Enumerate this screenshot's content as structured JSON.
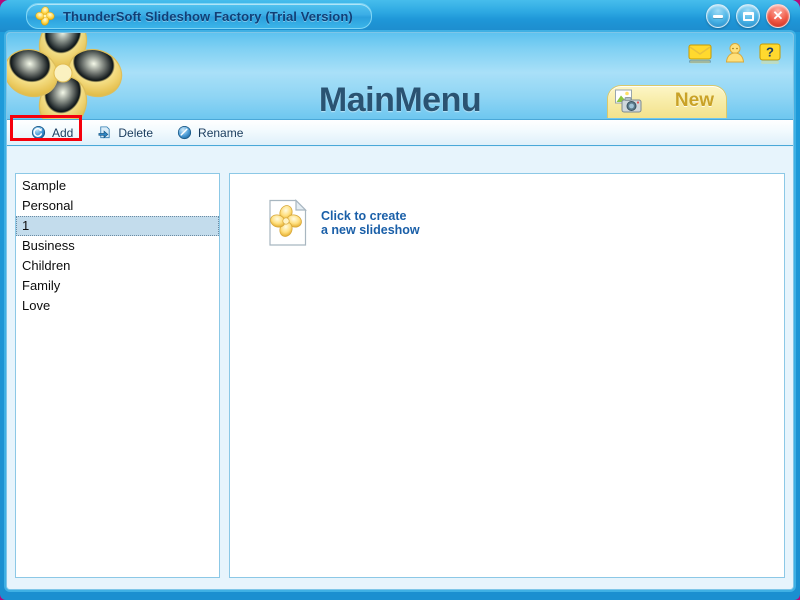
{
  "window": {
    "title": "ThunderSoft Slideshow Factory (Trial Version)",
    "app_icon": "flower-icon",
    "controls": {
      "minimize": "–",
      "maximize": "□",
      "close": "✕"
    }
  },
  "header": {
    "page_title": "MainMenu",
    "logo": "flower-logo",
    "new_button": {
      "label": "New",
      "icon": "photo-camera-icon"
    },
    "icons": [
      {
        "name": "mail-icon",
        "title": "Mail"
      },
      {
        "name": "user-icon",
        "title": "User"
      },
      {
        "name": "help-icon",
        "title": "Help"
      }
    ]
  },
  "toolbar": {
    "add_label": "Add",
    "delete_label": "Delete",
    "rename_label": "Rename",
    "add_icon": "refresh-circle-icon",
    "delete_icon": "delete-page-icon",
    "rename_icon": "rename-circle-icon"
  },
  "categories": {
    "items": [
      {
        "label": "Sample",
        "selected": false
      },
      {
        "label": "Personal",
        "selected": false
      },
      {
        "label": "1",
        "selected": true
      },
      {
        "label": "Business",
        "selected": false
      },
      {
        "label": "Children",
        "selected": false
      },
      {
        "label": "Family",
        "selected": false
      },
      {
        "label": "Love",
        "selected": false
      }
    ]
  },
  "content": {
    "create_tile": {
      "line1": "Click to create",
      "line2": "a new slideshow",
      "icon": "new-slideshow-document-icon"
    }
  },
  "annotation": {
    "target": "Add",
    "color": "#f5000c"
  },
  "colors": {
    "title_bar": "#2da8e2",
    "header_gradient_top": "#5ec2ef",
    "header_gradient_mid": "#a9e0f8",
    "frame": "#1f9ddb",
    "panel_border": "#8cc8e6",
    "selection": "#c3dcec",
    "link_text": "#1a5fa8",
    "title_text": "#2a5372",
    "new_button": "#f3e28c",
    "annotation_red": "#f5000c"
  }
}
